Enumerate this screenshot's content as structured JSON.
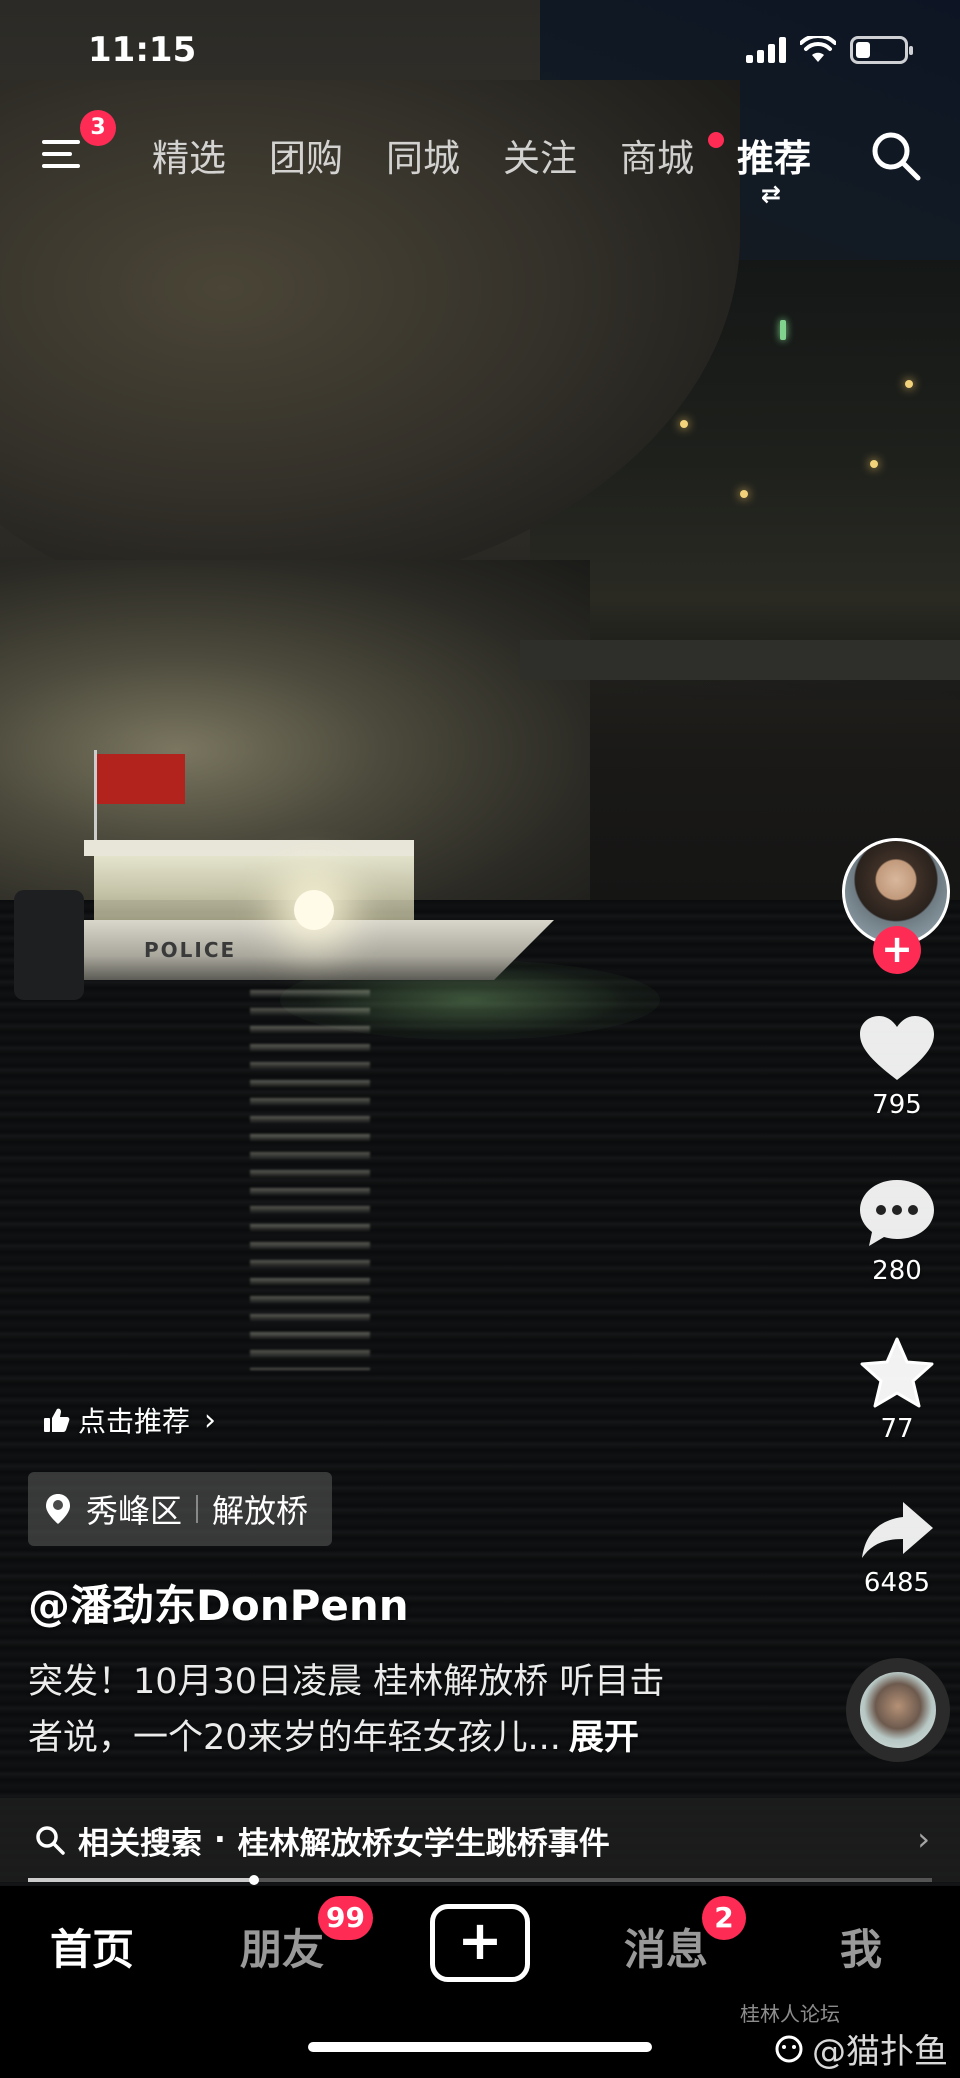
{
  "status_bar": {
    "time": "11:15"
  },
  "top_nav": {
    "menu_badge": "3",
    "tabs": [
      {
        "label": "精选"
      },
      {
        "label": "团购"
      },
      {
        "label": "同城"
      },
      {
        "label": "关注"
      },
      {
        "label": "商城",
        "has_dot": true
      },
      {
        "label": "推荐",
        "active": true,
        "swap_icon": "⇄"
      }
    ]
  },
  "video": {
    "boat_text": "POLICE"
  },
  "actions": {
    "like_count": "795",
    "comment_count": "280",
    "favorite_count": "77",
    "share_count": "6485"
  },
  "info": {
    "recommend_label": "点击推荐",
    "location_district": "秀峰区",
    "location_place": "解放桥",
    "author": "@潘劲东DonPenn",
    "desc_line1": "突发！10月30日凌晨 桂林解放桥 听目击",
    "desc_line2": "者说，一个20来岁的年轻女孩儿...",
    "expand_label": "展开"
  },
  "related_search": {
    "prefix": "相关搜索",
    "separator": "·",
    "query": "桂林解放桥女学生跳桥事件"
  },
  "playback": {
    "progress": 0.25
  },
  "bottom_tabs": {
    "home": "首页",
    "friends": "朋友",
    "friends_badge": "99",
    "create": "+",
    "messages": "消息",
    "messages_badge": "2",
    "me": "我"
  },
  "watermark": {
    "text": "@猫扑鱼",
    "small_text": "桂林人论坛"
  },
  "colors": {
    "accent": "#fe2c55",
    "background": "#000000"
  }
}
